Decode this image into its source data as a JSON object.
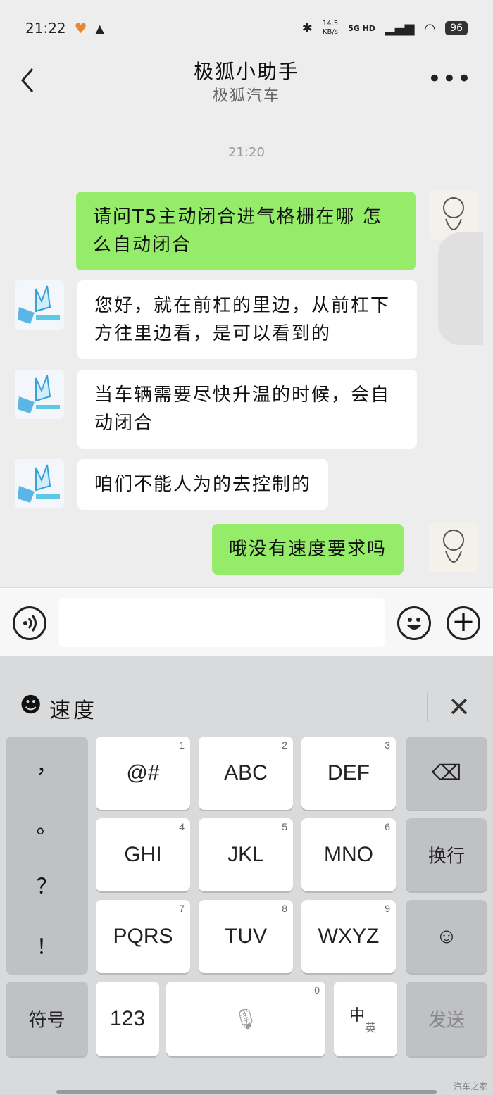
{
  "status_bar": {
    "time": "21:22",
    "net_speed_value": "14.5",
    "net_speed_unit": "KB/s",
    "network": "5G HD",
    "battery": "96"
  },
  "header": {
    "title": "极狐小助手",
    "subtitle": "极狐汽车",
    "back_icon": "chevron-left-icon",
    "more_icon": "more-icon"
  },
  "timestamp": "21:20",
  "messages": [
    {
      "side": "right",
      "text": "请问T5主动闭合进气格栅在哪 怎么自动闭合"
    },
    {
      "side": "left",
      "text": "您好，就在前杠的里边，从前杠下方往里边看，是可以看到的"
    },
    {
      "side": "left",
      "text": "当车辆需要尽快升温的时候，会自动闭合"
    },
    {
      "side": "left",
      "text": "咱们不能人为的去控制的"
    },
    {
      "side": "right",
      "text": "哦没有速度要求吗"
    }
  ],
  "input_bar": {
    "voice_icon": "voice-icon",
    "emoji_icon": "emoji-icon",
    "plus_icon": "plus-icon",
    "text": ""
  },
  "keyboard": {
    "suggestion": "速度",
    "punctuation": [
      "，",
      "。",
      "？",
      "！"
    ],
    "keys": [
      {
        "label": "@#",
        "num": "1"
      },
      {
        "label": "ABC",
        "num": "2"
      },
      {
        "label": "DEF",
        "num": "3"
      },
      {
        "label": "GHI",
        "num": "4"
      },
      {
        "label": "JKL",
        "num": "5"
      },
      {
        "label": "MNO",
        "num": "6"
      },
      {
        "label": "PQRS",
        "num": "7"
      },
      {
        "label": "TUV",
        "num": "8"
      },
      {
        "label": "WXYZ",
        "num": "9"
      }
    ],
    "newline": "换行",
    "symbols": "符号",
    "numbers": "123",
    "space_num": "0",
    "lang_main": "中",
    "lang_sub": "英",
    "send": "发送"
  },
  "watermark": "汽车之家"
}
